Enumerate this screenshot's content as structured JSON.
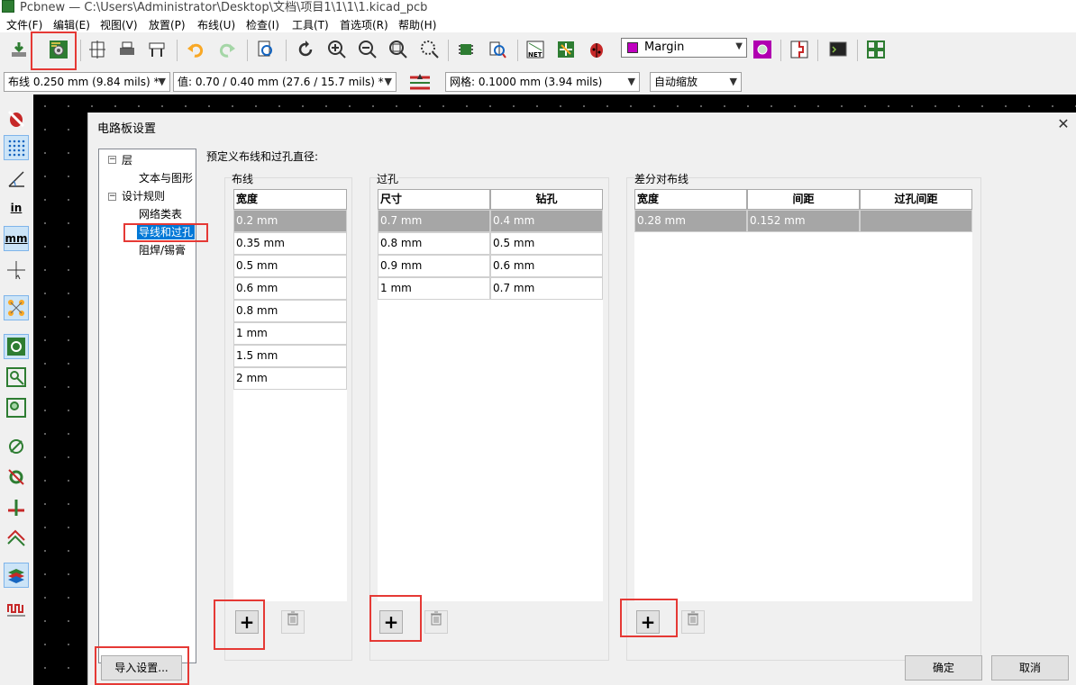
{
  "window": {
    "title": "Pcbnew — C:\\Users\\Administrator\\Desktop\\文档\\项目1\\1\\1\\1.kicad_pcb"
  },
  "menu": [
    "文件(F)",
    "编辑(E)",
    "视图(V)",
    "放置(P)",
    "布线(U)",
    "检查(I)",
    "工具(T)",
    "首选项(R)",
    "帮助(H)"
  ],
  "toolbar": {
    "layer": "Margin"
  },
  "options_bar": {
    "track": "布线 0.250 mm (9.84 mils) *",
    "via": "值: 0.70 / 0.40 mm (27.6 / 15.7 mils) *",
    "grid": "网格: 0.1000 mm (3.94 mils)",
    "zoom": "自动缩放"
  },
  "left_toolbar": {
    "in_label": "in",
    "mm_label": "mm"
  },
  "dialog": {
    "title": "电路板设置",
    "tree": {
      "layers": "层",
      "text_graphics": "文本与图形",
      "design_rules": "设计规则",
      "netclasses": "网络类表",
      "tracks_vias": "导线和过孔",
      "solder_mask": "阻焊/锡膏"
    },
    "predefined_label": "预定义布线和过孔直径:",
    "tracks": {
      "label": "布线",
      "header": "宽度",
      "rows": [
        "0.2 mm",
        "0.35 mm",
        "0.5 mm",
        "0.6 mm",
        "0.8 mm",
        "1 mm",
        "1.5 mm",
        "2 mm"
      ]
    },
    "vias": {
      "label": "过孔",
      "headers": [
        "尺寸",
        "钻孔"
      ],
      "rows": [
        [
          "0.7 mm",
          "0.4 mm"
        ],
        [
          "0.8 mm",
          "0.5 mm"
        ],
        [
          "0.9 mm",
          "0.6 mm"
        ],
        [
          "1 mm",
          "0.7 mm"
        ]
      ]
    },
    "diff_pairs": {
      "label": "差分对布线",
      "headers": [
        "宽度",
        "间距",
        "过孔间距"
      ],
      "rows": [
        [
          "0.28 mm",
          "0.152 mm",
          ""
        ]
      ]
    },
    "buttons": {
      "add": "+",
      "import": "导入设置...",
      "ok": "确定",
      "cancel": "取消"
    }
  },
  "colors": {
    "highlight": "#e53935",
    "selection": "#0078d7",
    "grid_selected": "#a6a6a6"
  }
}
